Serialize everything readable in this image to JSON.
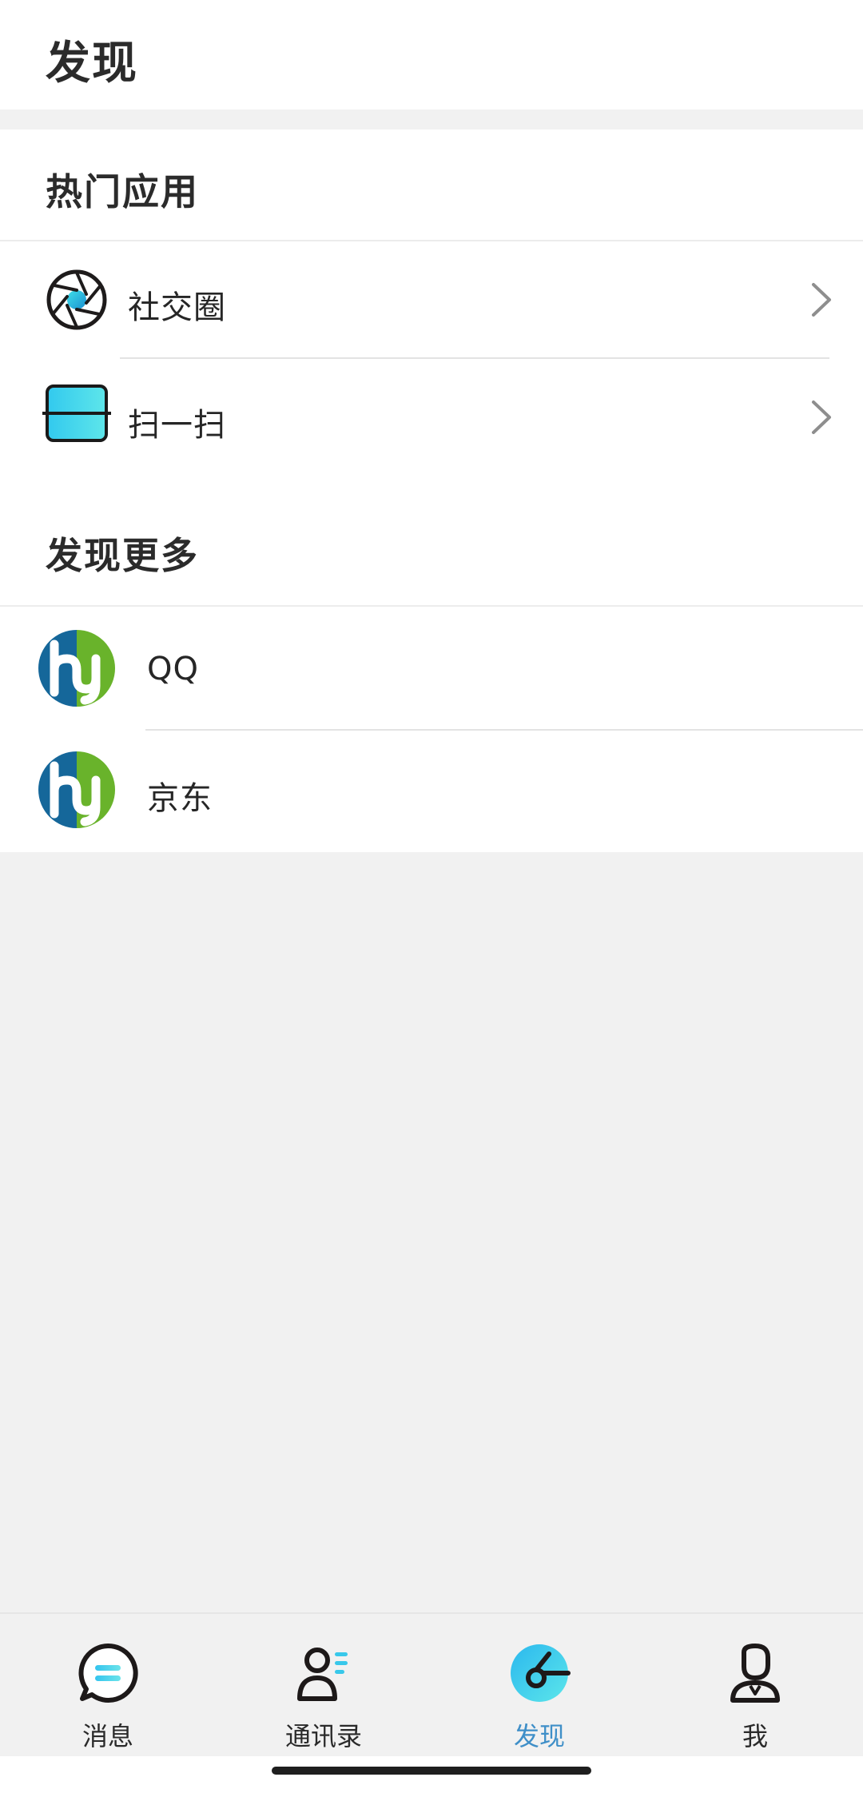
{
  "header": {
    "title": "发现"
  },
  "hot_apps": {
    "title": "热门应用",
    "items": [
      {
        "label": "社交圈",
        "icon": "camera-shutter-icon"
      },
      {
        "label": "扫一扫",
        "icon": "scan-icon"
      }
    ]
  },
  "discover_more": {
    "title": "发现更多",
    "items": [
      {
        "label": "QQ",
        "icon": "hy-logo-icon"
      },
      {
        "label": "京东",
        "icon": "hy-logo-icon"
      }
    ]
  },
  "tabbar": {
    "tabs": [
      {
        "label": "消息",
        "icon": "message-icon"
      },
      {
        "label": "通讯录",
        "icon": "contacts-icon"
      },
      {
        "label": "发现",
        "icon": "discover-icon",
        "active": true
      },
      {
        "label": "我",
        "icon": "profile-icon"
      }
    ]
  },
  "colors": {
    "accent": "#3f8fc8",
    "icon_cyan": "#2bd4e6",
    "logo_blue": "#15679a",
    "logo_green": "#69b32b"
  }
}
